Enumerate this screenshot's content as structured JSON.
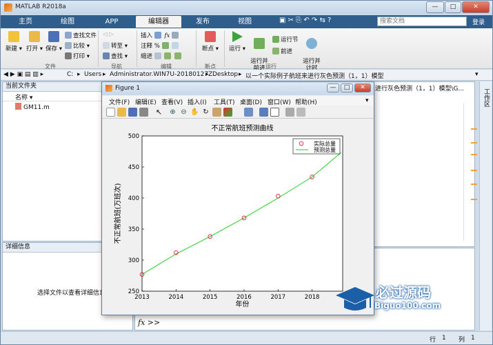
{
  "window": {
    "title": "MATLAB R2018a",
    "controls": [
      "—",
      "□",
      "✕"
    ]
  },
  "tabs": {
    "items": [
      "主页",
      "绘图",
      "APP",
      "编辑器",
      "发布",
      "视图"
    ],
    "active": "编辑器"
  },
  "search": {
    "placeholder": "搜索文档"
  },
  "login": "登录",
  "ribbon": {
    "file": {
      "new": "新建",
      "open": "打开",
      "save": "保存",
      "find_files": "查找文件",
      "compare": "比较",
      "print": "打印",
      "group": "文件"
    },
    "navigate": {
      "goto": "转至",
      "find": "查找",
      "group": "导航"
    },
    "edit": {
      "insert": "插入",
      "comment": "注释",
      "indent": "缩进",
      "group": "编辑"
    },
    "breakpoints": {
      "label": "断点",
      "group": "断点"
    },
    "run": {
      "run": "运行",
      "run_advance": "运行并\n前进",
      "run_section": "运行节",
      "advance": "前进",
      "run_time": "运行并\n计时",
      "group": "运行"
    }
  },
  "address": {
    "path": [
      "C:",
      "Users",
      "Administrator.WIN7U-20180127Z",
      "Desktop",
      "以一个实际例子航班来进行灰色预测（1，1）模型"
    ]
  },
  "current_folder": {
    "title": "当前文件夹",
    "column": "名称",
    "files": [
      "GM11.m"
    ]
  },
  "details": {
    "title": "详细信息",
    "empty": "选择文件以查看详细信息"
  },
  "editor_tab": "进行灰色预测（1，1）模型\\G...",
  "workspace_label": "工作区",
  "command": {
    "prompt": "fx >>"
  },
  "status": {
    "row_label": "行",
    "row": "1",
    "col_label": "列",
    "col": "1"
  },
  "figure": {
    "title": "Figure 1",
    "menu": [
      "文件(F)",
      "编辑(E)",
      "查看(V)",
      "插入(I)",
      "工具(T)",
      "桌面(D)",
      "窗口(W)",
      "帮助(H)"
    ]
  },
  "chart_data": {
    "type": "line",
    "title": "不正常航班预测曲线",
    "xlabel": "年份",
    "ylabel": "不正常航班(万班次)",
    "xlim": [
      2013,
      2018.9
    ],
    "ylim": [
      250,
      500
    ],
    "xticks": [
      2013,
      2014,
      2015,
      2016,
      2017,
      2018
    ],
    "yticks": [
      250,
      300,
      350,
      400,
      450,
      500
    ],
    "series": [
      {
        "name": "实际总量",
        "marker": "circle",
        "color": "#e0203a",
        "x": [
          2013,
          2014,
          2015,
          2016,
          2017,
          2018
        ],
        "y": [
          277,
          312,
          338,
          368,
          403,
          434
        ]
      },
      {
        "name": "预测总量",
        "marker": "none",
        "color": "#22cc22",
        "x": [
          2013,
          2014,
          2015,
          2016,
          2017,
          2018,
          2018.85
        ],
        "y": [
          277,
          310,
          338,
          368,
          400,
          434,
          473
        ]
      }
    ],
    "legend": "top-right"
  },
  "watermark": {
    "brand": "必过源码",
    "url": "Biguo100.com"
  }
}
